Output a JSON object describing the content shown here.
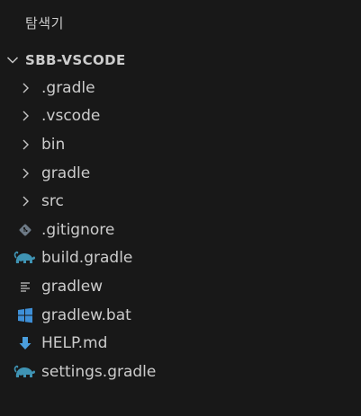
{
  "panel": {
    "title": "탐색기"
  },
  "workspace": {
    "name": "SBB-VSCODE",
    "expanded": true
  },
  "tree": {
    "items": [
      {
        "label": ".gradle",
        "kind": "folder",
        "icon": "chevron-right-icon"
      },
      {
        "label": ".vscode",
        "kind": "folder",
        "icon": "chevron-right-icon"
      },
      {
        "label": "bin",
        "kind": "folder",
        "icon": "chevron-right-icon"
      },
      {
        "label": "gradle",
        "kind": "folder",
        "icon": "chevron-right-icon"
      },
      {
        "label": "src",
        "kind": "folder",
        "icon": "chevron-right-icon"
      },
      {
        "label": ".gitignore",
        "kind": "file",
        "icon": "git-icon"
      },
      {
        "label": "build.gradle",
        "kind": "file",
        "icon": "gradle-elephant-icon"
      },
      {
        "label": "gradlew",
        "kind": "file",
        "icon": "text-lines-icon"
      },
      {
        "label": "gradlew.bat",
        "kind": "file",
        "icon": "windows-icon"
      },
      {
        "label": "HELP.md",
        "kind": "file",
        "icon": "markdown-arrow-down-icon"
      },
      {
        "label": "settings.gradle",
        "kind": "file",
        "icon": "gradle-elephant-icon"
      }
    ]
  },
  "colors": {
    "background": "#181818",
    "text": "#cccccc",
    "chevron": "#c5c5c5",
    "gradle_blue": "#3f93b3",
    "windows_blue": "#3e8fd6",
    "markdown_blue": "#4a9edd",
    "git_gray": "#6d7a86"
  }
}
